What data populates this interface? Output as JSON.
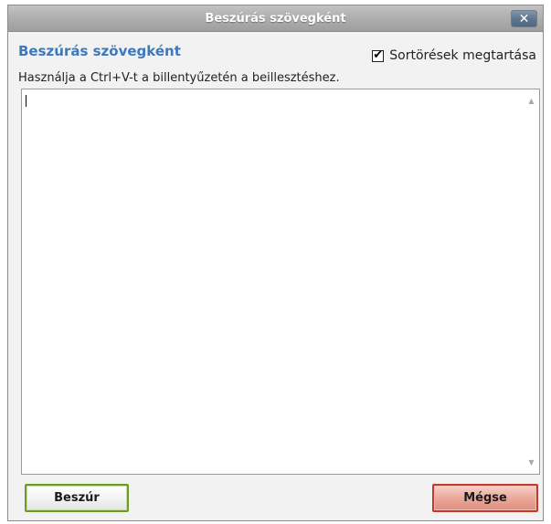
{
  "dialog": {
    "title": "Beszúrás szövegként",
    "close_symbol": "✕",
    "heading": "Beszúrás szövegként",
    "keep_linebreaks": {
      "label": "Sortörések megtartása",
      "checked": true,
      "check_symbol": "✔"
    },
    "instruction": "Használja a Ctrl+V-t a billentyűzetén a beillesztéshez.",
    "paste_area": {
      "value": ""
    },
    "scroll_up_symbol": "▲",
    "scroll_down_symbol": "▼",
    "buttons": {
      "insert_label": "Beszúr",
      "cancel_label": "Mégse"
    }
  },
  "colors": {
    "heading": "#3d78bd",
    "insert_border": "#6c9b2a",
    "cancel_border": "#c0392b",
    "titlebar": "#b0b0b0"
  }
}
